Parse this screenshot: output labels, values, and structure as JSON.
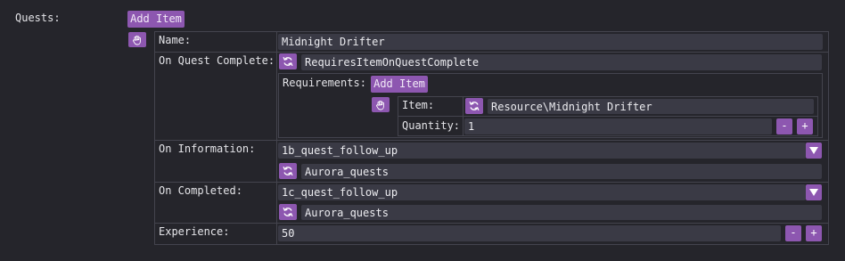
{
  "quests_label": "Quests:",
  "add_item_label": "Add Item",
  "name_label": "Name:",
  "name_value": "Midnight Drifter",
  "on_quest_complete_label": "On Quest Complete:",
  "on_quest_complete_value": "RequiresItemOnQuestComplete",
  "requirements_label": "Requirements:",
  "requirements_add_item_label": "Add Item",
  "item_label": "Item:",
  "item_value": "Resource\\Midnight Drifter",
  "quantity_label": "Quantity:",
  "quantity_value": "1",
  "on_information_label": "On Information:",
  "on_information_value": "1b_quest_follow_up",
  "on_information_sub_value": "Aurora_quests",
  "on_completed_label": "On Completed:",
  "on_completed_value": "1c_quest_follow_up",
  "on_completed_sub_value": "Aurora_quests",
  "experience_label": "Experience:",
  "experience_value": "50",
  "minus_symbol": "-",
  "plus_symbol": "+",
  "colors": {
    "background": "#25252b",
    "field": "#3a3a45",
    "accent": "#8d57b0",
    "border": "#44444e",
    "text": "#e4e4e8"
  }
}
